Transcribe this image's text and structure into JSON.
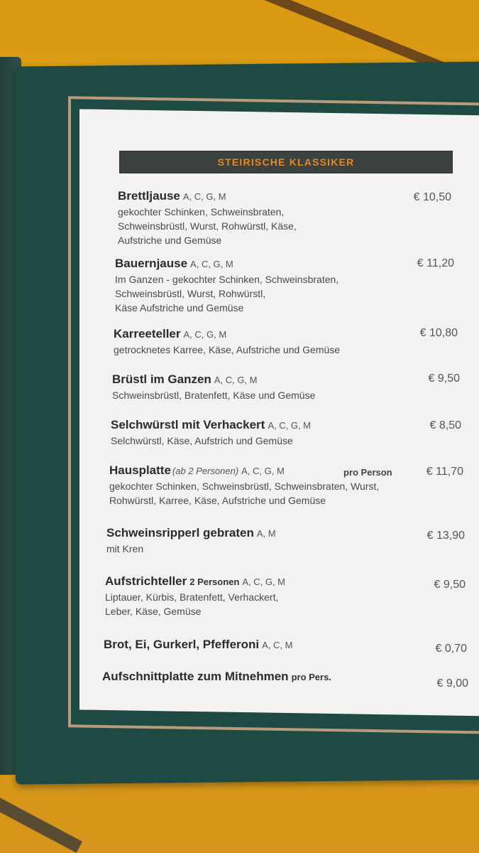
{
  "menu": {
    "section_title": "STEIRISCHE KLASSIKER",
    "items": [
      {
        "name": "Brettljause",
        "allergens": "A, C, G, M",
        "desc1": "gekochter Schinken, Schweinsbraten,",
        "desc2": "Schweinsbrüstl, Wurst, Rohwürstl, Käse,",
        "desc3": "Aufstriche und Gemüse",
        "price": "€ 10,50"
      },
      {
        "name": "Bauernjause",
        "allergens": "A, C, G, M",
        "desc1": "Im Ganzen -  gekochter Schinken, Schweinsbraten,",
        "desc2": "Schweinsbrüstl, Wurst, Rohwürstl,",
        "desc3": "Käse Aufstriche und Gemüse",
        "price": "€ 11,20"
      },
      {
        "name": "Karreeteller",
        "allergens": "A, C, G, M",
        "desc1": "getrocknetes Karree, Käse, Aufstriche und Gemüse",
        "price": "€ 10,80"
      },
      {
        "name": "Brüstl im Ganzen",
        "allergens": "A, C, G, M",
        "desc1": "Schweinsbrüstl, Bratenfett, Käse und Gemüse",
        "price": "€  9,50"
      },
      {
        "name": "Selchwürstl mit Verhackert",
        "allergens": "A, C, G, M",
        "desc1": "Selchwürstl, Käse, Aufstrich und Gemüse",
        "price": "€  8,50"
      },
      {
        "name": "Hausplatte",
        "note": "(ab 2 Personen)",
        "allergens": "A, C, G, M",
        "per_person": "pro Person",
        "desc1": "gekochter Schinken, Schweinsbrüstl, Schweinsbraten, Wurst,",
        "desc2": "Rohwürstl, Karree, Käse, Aufstriche und Gemüse",
        "price": "€ 11,70"
      },
      {
        "name": "Schweinsripperl gebraten",
        "allergens": "A, M",
        "desc1": "mit Kren",
        "price": "€ 13,90"
      },
      {
        "name": "Aufstrichteller",
        "extra": "2 Personen",
        "allergens": "A, C, G, M",
        "desc1": "Liptauer, Kürbis, Bratenfett, Verhackert,",
        "desc2": "Leber, Käse, Gemüse",
        "price": "€  9,50"
      },
      {
        "name": "Brot, Ei, Gurkerl, Pfefferoni",
        "allergens": "A, C, M",
        "price": "€  0,70"
      },
      {
        "name": "Aufschnittplatte zum Mitnehmen",
        "extra": "pro Pers.",
        "price": "€  9,00"
      }
    ]
  }
}
